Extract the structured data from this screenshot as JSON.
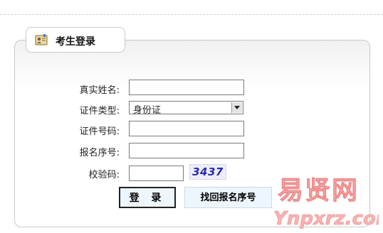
{
  "panel": {
    "title": "考生登录",
    "icon": "user-card-icon"
  },
  "form": {
    "name_label": "真实姓名:",
    "name_value": "",
    "id_type_label": "证件类型:",
    "id_type_selected": "身份证",
    "id_number_label": "证件号码:",
    "id_number_value": "",
    "reg_number_label": "报名序号:",
    "reg_number_value": "",
    "captcha_label": "校验码:",
    "captcha_value": "",
    "captcha_image_text": "3437"
  },
  "buttons": {
    "login": "登 录",
    "find_reg_number": "找回报名序号"
  },
  "watermark": {
    "cn": "易贤网",
    "url": "Ynpxrz.com",
    "color": "#f4a4a4"
  }
}
